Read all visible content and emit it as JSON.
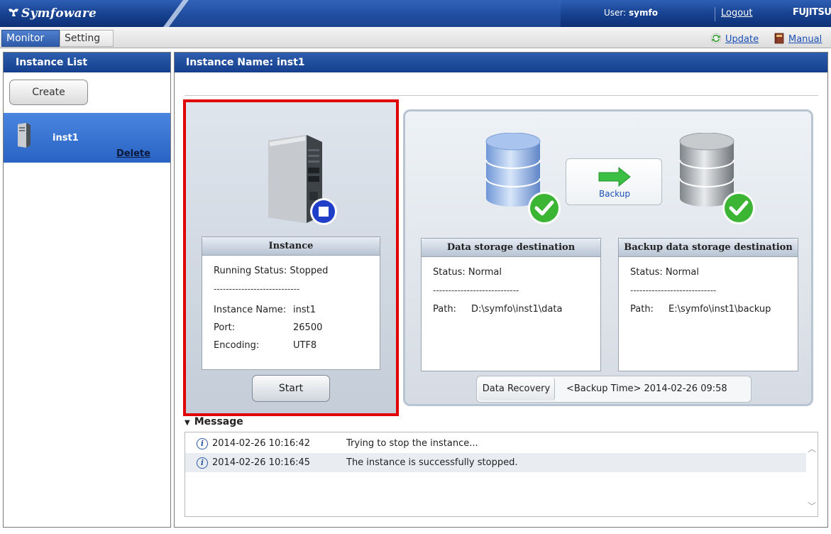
{
  "header": {
    "logo": "Symfoware",
    "user_label": "User:",
    "user_name": "symfo",
    "logout": "Logout",
    "vendor": "FUJITSU"
  },
  "menu": {
    "tabs": [
      "Monitor",
      "Setting"
    ],
    "active_tab": "Monitor",
    "update": "Update",
    "manual": "Manual"
  },
  "sidebar": {
    "title": "Instance List",
    "create": "Create",
    "instances": [
      {
        "name": "inst1",
        "delete": "Delete",
        "selected": true
      }
    ]
  },
  "main": {
    "title": "Instance Name: inst1",
    "instance_card": {
      "title": "Instance",
      "running_status": "Running Status:  Stopped",
      "dashes": "----------------------------",
      "name_label": "Instance Name:",
      "name_value": "inst1",
      "port_label": "Port:",
      "port_value": "26500",
      "encoding_label": "Encoding:",
      "encoding_value": "UTF8",
      "start": "Start"
    },
    "backup_label": "Backup",
    "data_storage": {
      "title": "Data storage destination",
      "status": "Status:  Normal",
      "dashes": "----------------------------",
      "path_label": "Path:",
      "path_value": "D:\\symfo\\inst1\\data"
    },
    "backup_storage": {
      "title": "Backup data storage destination",
      "status": "Status:  Normal",
      "dashes": "----------------------------",
      "path_label": "Path:",
      "path_value": "E:\\symfo\\inst1\\backup"
    },
    "recovery": {
      "button": "Data Recovery",
      "backup_time": "<Backup Time> 2014-02-26 09:58"
    },
    "messages": {
      "title": "Message",
      "items": [
        {
          "time": "2014-02-26 10:16:42",
          "text": "Trying to stop the instance..."
        },
        {
          "time": "2014-02-26 10:16:45",
          "text": "The instance is successfully stopped."
        }
      ]
    }
  },
  "colors": {
    "header_blue": "#16408f",
    "highlight_border": "#e00000",
    "selected_item": "#2a63c4",
    "status_check": "#3bb533",
    "stop_badge": "#1f3fc9"
  }
}
